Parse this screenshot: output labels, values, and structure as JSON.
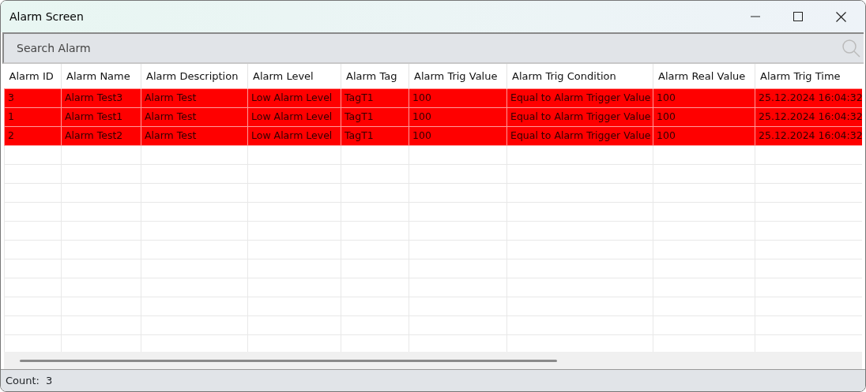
{
  "window": {
    "title": "Alarm Screen"
  },
  "search": {
    "placeholder": "Search Alarm"
  },
  "table": {
    "columns": [
      "Alarm ID",
      "Alarm Name",
      "Alarm Description",
      "Alarm Level",
      "Alarm Tag",
      "Alarm Trig Value",
      "Alarm Trig Condition",
      "Alarm Real Value",
      "Alarm Trig Time"
    ],
    "rows": [
      [
        "3",
        "Alarm Test3",
        "Alarm Test",
        "Low Alarm Level",
        "TagT1",
        "100",
        "Equal to Alarm Trigger Value",
        "100",
        "25.12.2024 16:04:32"
      ],
      [
        "1",
        "Alarm Test1",
        "Alarm Test",
        "Low Alarm Level",
        "TagT1",
        "100",
        "Equal to Alarm Trigger Value",
        "100",
        "25.12.2024 16:04:32"
      ],
      [
        "2",
        "Alarm Test2",
        "Alarm Test",
        "Low Alarm Level",
        "TagT1",
        "100",
        "Equal to Alarm Trigger Value",
        "100",
        "25.12.2024 16:04:32"
      ]
    ]
  },
  "status_bar": {
    "label": "Count:",
    "value": "3"
  }
}
